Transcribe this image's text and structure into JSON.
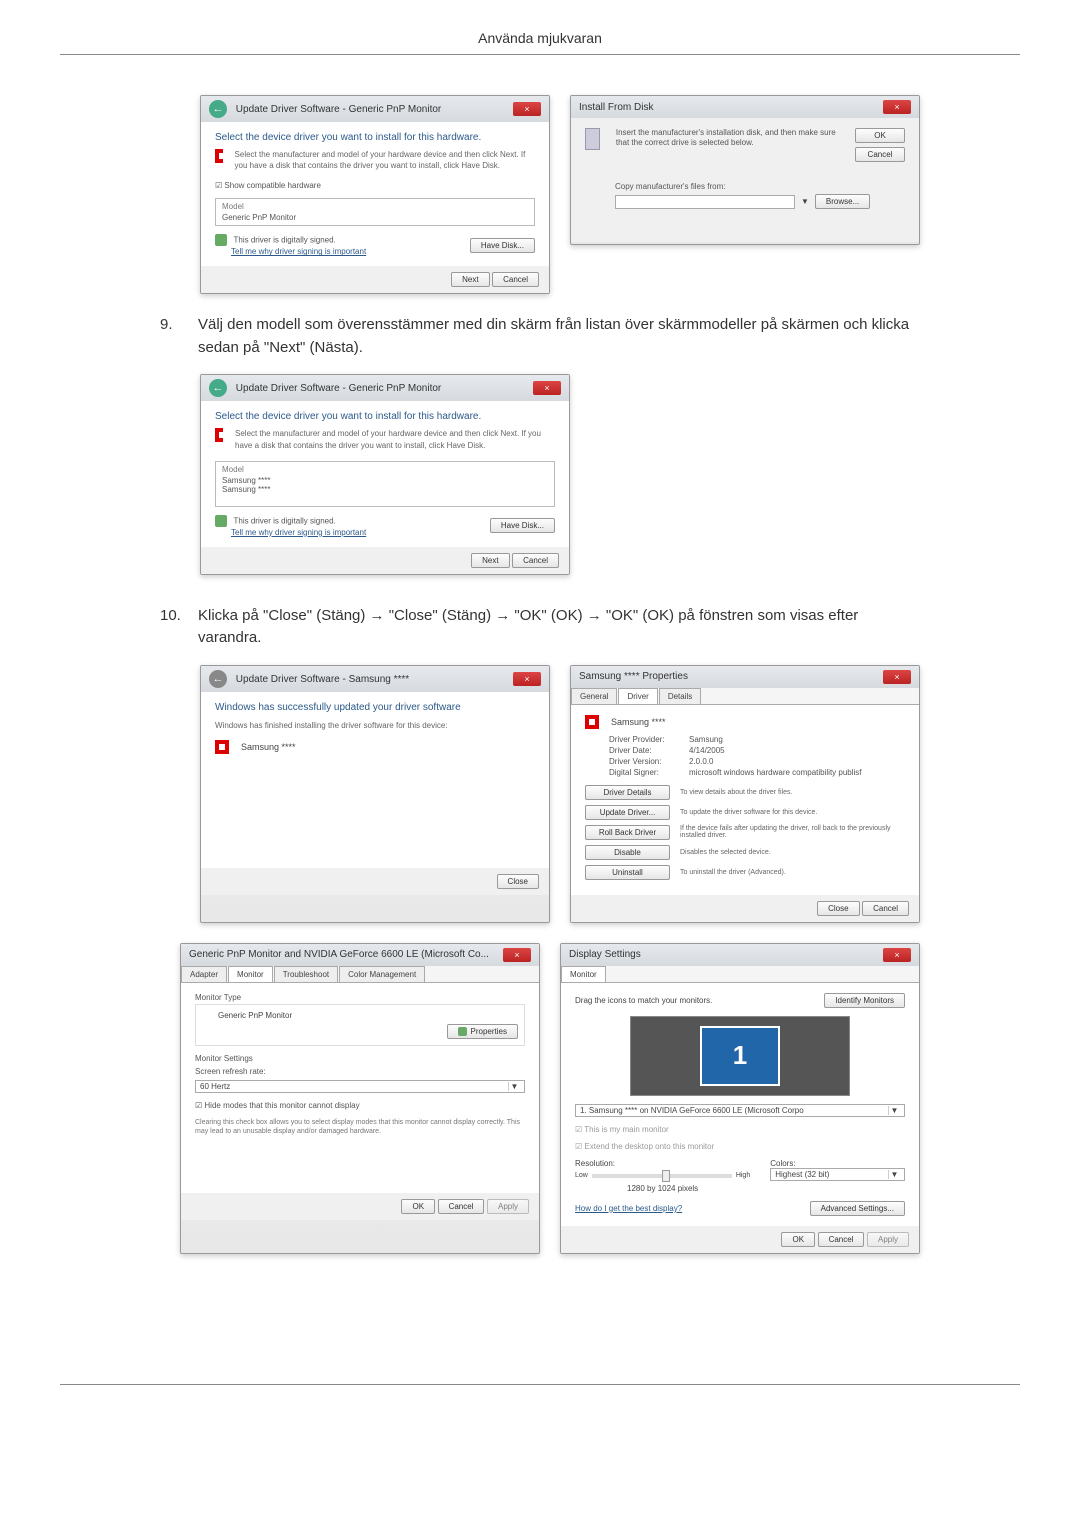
{
  "header": {
    "title": "Använda mjukvaran"
  },
  "step9": {
    "num": "9.",
    "text": "Välj den modell som överensstämmer med din skärm från listan över skärmmodeller på skärmen och klicka sedan på \"Next\" (Nästa)."
  },
  "step10": {
    "num": "10.",
    "text": "Klicka på \"Close\" (Stäng) → \"Close\" (Stäng) → \"OK\" (OK) → \"OK\" (OK) på fönstren som visas efter varandra."
  },
  "dlg_update1": {
    "title": "Update Driver Software - Generic PnP Monitor",
    "heading": "Select the device driver you want to install for this hardware.",
    "desc": "Select the manufacturer and model of your hardware device and then click Next. If you have a disk that contains the driver you want to install, click Have Disk.",
    "checkbox": "Show compatible hardware",
    "list_label": "Model",
    "list_item": "Generic PnP Monitor",
    "signed": "This driver is digitally signed.",
    "signed_link": "Tell me why driver signing is important",
    "have_disk": "Have Disk...",
    "next": "Next",
    "cancel": "Cancel"
  },
  "dlg_install_from_disk": {
    "title": "Install From Disk",
    "text": "Insert the manufacturer's installation disk, and then make sure that the correct drive is selected below.",
    "copy": "Copy manufacturer's files from:",
    "ok": "OK",
    "cancel": "Cancel",
    "browse": "Browse..."
  },
  "dlg_update2": {
    "title": "Update Driver Software - Generic PnP Monitor",
    "heading": "Select the device driver you want to install for this hardware.",
    "desc": "Select the manufacturer and model of your hardware device and then click Next. If you have a disk that contains the driver you want to install, click Have Disk.",
    "list_label": "Model",
    "item1": "Samsung ****",
    "item2": "Samsung ****",
    "signed": "This driver is digitally signed.",
    "signed_link": "Tell me why driver signing is important",
    "have_disk": "Have Disk...",
    "next": "Next",
    "cancel": "Cancel"
  },
  "dlg_success": {
    "title": "Update Driver Software - Samsung ****",
    "heading": "Windows has successfully updated your driver software",
    "desc": "Windows has finished installing the driver software for this device:",
    "device": "Samsung ****",
    "close": "Close"
  },
  "dlg_props": {
    "title": "Samsung **** Properties",
    "tabs": [
      "General",
      "Driver",
      "Details"
    ],
    "device": "Samsung ****",
    "rows": [
      {
        "k": "Driver Provider:",
        "v": "Samsung"
      },
      {
        "k": "Driver Date:",
        "v": "4/14/2005"
      },
      {
        "k": "Driver Version:",
        "v": "2.0.0.0"
      },
      {
        "k": "Digital Signer:",
        "v": "microsoft windows hardware compatibility publisf"
      }
    ],
    "btns": [
      {
        "label": "Driver Details",
        "desc": "To view details about the driver files."
      },
      {
        "label": "Update Driver...",
        "desc": "To update the driver software for this device."
      },
      {
        "label": "Roll Back Driver",
        "desc": "If the device fails after updating the driver, roll back to the previously installed driver."
      },
      {
        "label": "Disable",
        "desc": "Disables the selected device."
      },
      {
        "label": "Uninstall",
        "desc": "To uninstall the driver (Advanced)."
      }
    ],
    "close": "Close",
    "cancel": "Cancel"
  },
  "dlg_monitor_tab": {
    "title": "Generic PnP Monitor and NVIDIA GeForce 6600 LE (Microsoft Co...",
    "tabs": [
      "Adapter",
      "Monitor",
      "Troubleshoot",
      "Color Management"
    ],
    "type_label": "Monitor Type",
    "type_value": "Generic PnP Monitor",
    "properties": "Properties",
    "settings_label": "Monitor Settings",
    "refresh_label": "Screen refresh rate:",
    "refresh_value": "60 Hertz",
    "hide": "Hide modes that this monitor cannot display",
    "hide_desc": "Clearing this check box allows you to select display modes that this monitor cannot display correctly. This may lead to an unusable display and/or damaged hardware.",
    "ok": "OK",
    "cancel": "Cancel",
    "apply": "Apply"
  },
  "dlg_display": {
    "title": "Display Settings",
    "tab": "Monitor",
    "drag": "Drag the icons to match your monitors.",
    "identify": "Identify Monitors",
    "monitor_num": "1",
    "select_value": "1. Samsung **** on NVIDIA GeForce 6600 LE (Microsoft Corpo",
    "main": "This is my main monitor",
    "extend": "Extend the desktop onto this monitor",
    "res_label": "Resolution:",
    "low": "Low",
    "high": "High",
    "res_value": "1280 by 1024 pixels",
    "colors_label": "Colors:",
    "colors_value": "Highest (32 bit)",
    "best": "How do I get the best display?",
    "advanced": "Advanced Settings...",
    "ok": "OK",
    "cancel": "Cancel",
    "apply": "Apply"
  }
}
